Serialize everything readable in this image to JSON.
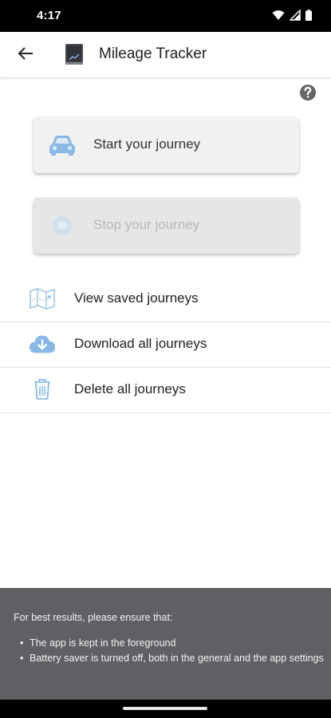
{
  "status_bar": {
    "time": "4:17",
    "icons": [
      "wifi-icon",
      "signal-icon",
      "battery-icon"
    ]
  },
  "app_bar": {
    "title": "Mileage Tracker",
    "back_icon": "arrow-left-icon",
    "logo_icon": "app-logo-icon"
  },
  "help": {
    "icon": "help-circle-icon"
  },
  "actions": {
    "start": {
      "label": "Start your journey",
      "icon": "car-icon",
      "enabled": true
    },
    "stop": {
      "label": "Stop your journey",
      "icon": "stop-circle-icon",
      "enabled": false
    }
  },
  "menu": [
    {
      "label": "View saved journeys",
      "icon": "map-icon"
    },
    {
      "label": "Download all journeys",
      "icon": "cloud-download-icon"
    },
    {
      "label": "Delete all journeys",
      "icon": "trash-icon"
    }
  ],
  "footer": {
    "intro": "For best results, please ensure that:",
    "tips": [
      "The app is kept in the foreground",
      "Battery saver is turned off, both in the general and the app settings"
    ]
  },
  "colors": {
    "accent": "#86b9e6",
    "footer_bg": "#5f6063",
    "status_bar": "#000000"
  }
}
